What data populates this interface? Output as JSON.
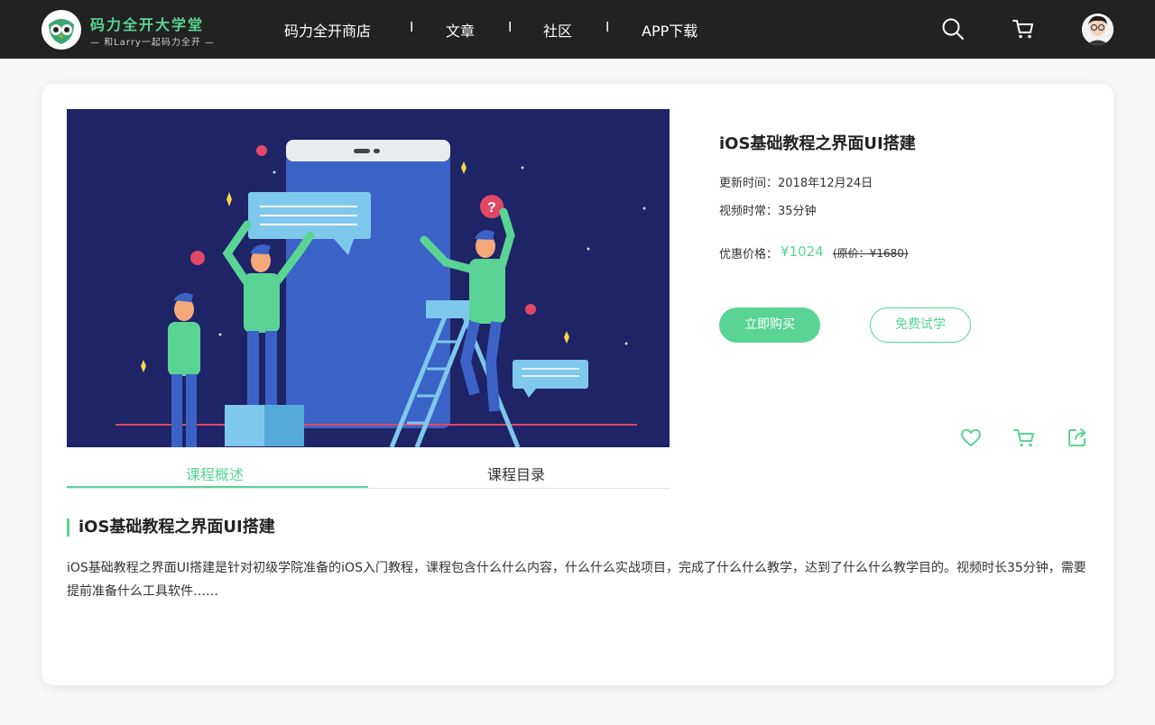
{
  "header": {
    "brand_name": "码力全开大学堂",
    "slogan": "— 和Larry一起码力全开 —",
    "nav": [
      "码力全开商店",
      "文章",
      "社区",
      "APP下载"
    ],
    "separator": "I",
    "icons": {
      "search": "search-icon",
      "cart": "cart-icon"
    }
  },
  "course": {
    "title": "iOS基础教程之界面UI搭建",
    "updated_label": "更新时间：",
    "updated_value": "2018年12月24日",
    "duration_label": "视频时常：",
    "duration_value": "35分钟",
    "price_label": "优惠价格：",
    "price": "¥1024",
    "original_price": "(原价：¥1680)",
    "buy_label": "立即购买",
    "trial_label": "免费试学"
  },
  "tabs": [
    "课程概述",
    "课程目录"
  ],
  "overview": {
    "heading": "iOS基础教程之界面UI搭建",
    "text": "iOS基础教程之界面UI搭建是针对初级学院准备的iOS入门教程，课程包含什么什么内容，什么什么实战项目，完成了什么什么教学，达到了什么什么教学目的。视频时长35分钟，需要提前准备什么工具软件……"
  },
  "colors": {
    "accent": "#5ad495",
    "header_bg": "#222222",
    "hero_bg": "#1e2466"
  }
}
